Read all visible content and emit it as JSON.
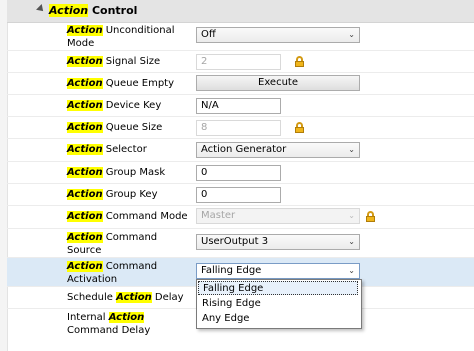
{
  "category": {
    "highlight": "Action",
    "rest": " Control"
  },
  "keyword": "Action",
  "rows": [
    {
      "pre": "",
      "post": " Unconditional",
      "line2": "Mode",
      "value": "Off"
    },
    {
      "pre": "",
      "post": " Signal Size",
      "value": "2"
    },
    {
      "pre": "",
      "post": " Queue Empty",
      "button": "Execute"
    },
    {
      "pre": "",
      "post": " Device Key",
      "value": "N/A"
    },
    {
      "pre": "",
      "post": " Queue Size",
      "value": "8"
    },
    {
      "pre": "",
      "post": " Selector",
      "value": "Action Generator"
    },
    {
      "pre": "",
      "post": " Group Mask",
      "value": "0"
    },
    {
      "pre": "",
      "post": " Group Key",
      "value": "0"
    },
    {
      "pre": "",
      "post": " Command Mode",
      "value": "Master"
    },
    {
      "pre": "",
      "post": " Command",
      "line2": "Source",
      "value": "UserOutput 3"
    },
    {
      "pre": "",
      "post": " Command",
      "line2": "Activation",
      "value": "Falling Edge"
    },
    {
      "pre": "Schedule ",
      "post": " Delay",
      "value": ""
    },
    {
      "pre": "Internal ",
      "post": "",
      "line2": "Command Delay",
      "value": ""
    }
  ],
  "dropdown_options": [
    "Falling Edge",
    "Rising Edge",
    "Any Edge"
  ],
  "selected_option": "Falling Edge",
  "icons": {
    "lock": "lock-icon",
    "chevron": "chevron-down-icon",
    "collapse": "collapse-triangle-icon"
  }
}
